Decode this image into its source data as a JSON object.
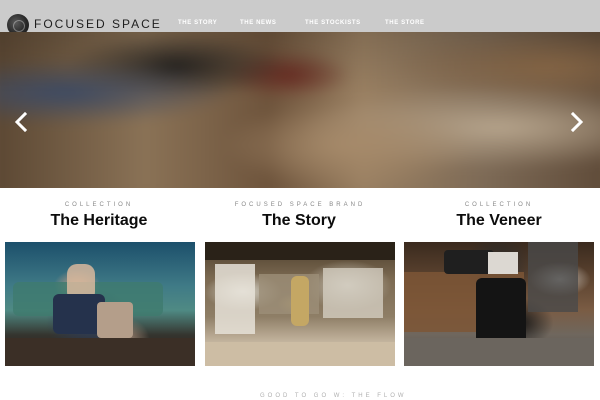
{
  "header": {
    "logo_text": "FOCUSED SPACE",
    "nav": [
      {
        "label": "THE STORY"
      },
      {
        "label": "THE NEWS"
      },
      {
        "label": "THE STOCKISTS"
      },
      {
        "label": "THE STORE"
      }
    ]
  },
  "hero": {
    "prev_icon": "chevron-left-icon",
    "next_icon": "chevron-right-icon"
  },
  "collections": [
    {
      "kicker": "COLLECTION",
      "title": "The Heritage"
    },
    {
      "kicker": "FOCUSED SPACE BRAND",
      "title": "The Story"
    },
    {
      "kicker": "COLLECTION",
      "title": "The Veneer"
    }
  ],
  "footer": {
    "kicker": "GOOD TO GO W: THE FLOW"
  },
  "colors": {
    "header_bg": "#cbcbcb",
    "nav_text": "#ffffff",
    "title_text": "#0c0c0c",
    "kicker_text": "#888888"
  }
}
